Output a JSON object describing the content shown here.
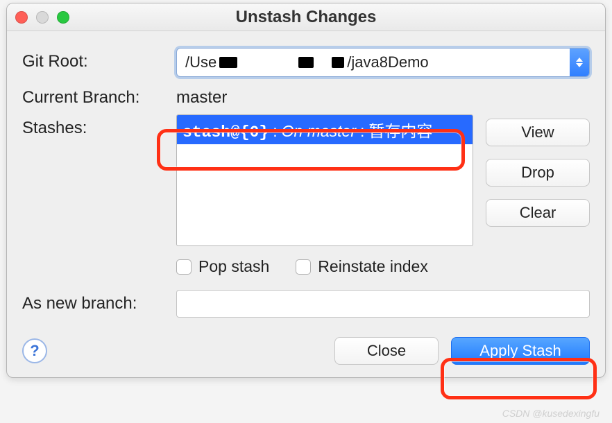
{
  "title": "Unstash Changes",
  "labels": {
    "git_root": "Git Root:",
    "current_branch": "Current Branch:",
    "stashes": "Stashes:",
    "pop_stash": "Pop stash",
    "reinstate_index": "Reinstate index",
    "as_new_branch": "As new branch:"
  },
  "values": {
    "git_root_prefix": "/Use",
    "git_root_suffix": "/java8Demo",
    "current_branch": "master",
    "new_branch": ""
  },
  "stashes": [
    {
      "id": "stash@{0}",
      "meta": "On master",
      "msg": "暂存内容"
    }
  ],
  "buttons": {
    "view": "View",
    "drop": "Drop",
    "clear": "Clear",
    "close": "Close",
    "apply": "Apply Stash",
    "help": "?"
  },
  "watermark": "CSDN @kusedexingfu"
}
